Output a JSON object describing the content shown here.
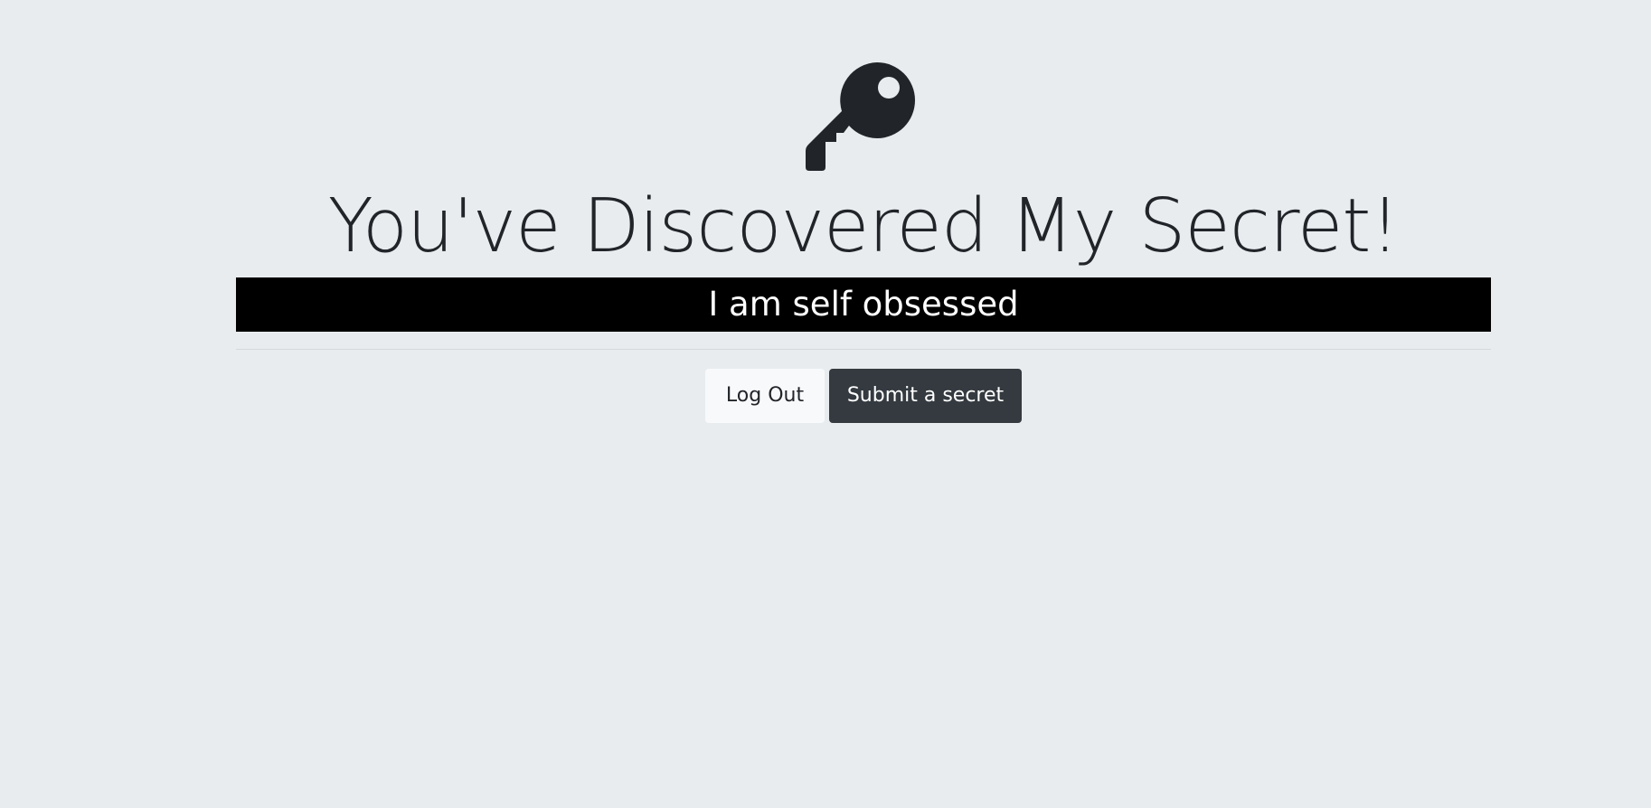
{
  "page": {
    "icon": "key-icon",
    "title": "You've Discovered My Secret!",
    "secret": "I am self obsessed",
    "background_color": "#e9ecef",
    "text_color": "#212529"
  },
  "actions": {
    "logout_label": "Log Out",
    "submit_label": "Submit a secret",
    "logout_color": "#f8f9fa",
    "submit_color": "#343a40"
  }
}
